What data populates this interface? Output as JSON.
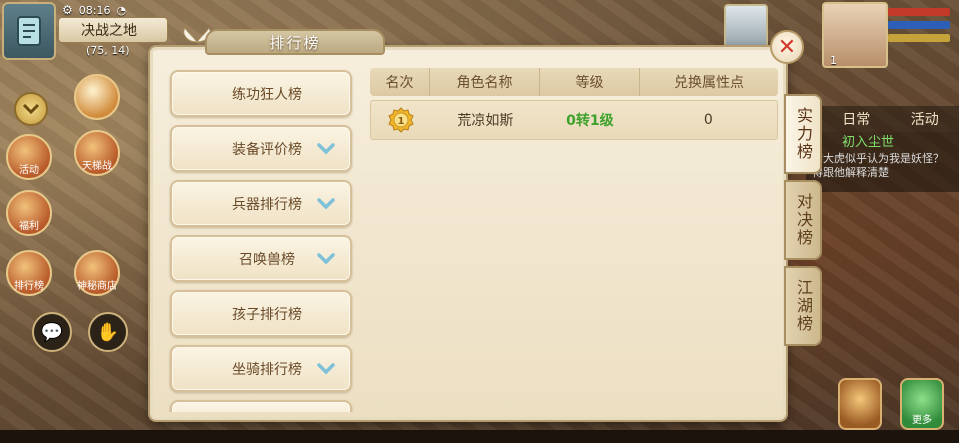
{
  "hud": {
    "time": "08:16",
    "location_name": "决战之地",
    "coords": "(75, 14)",
    "side_buttons": [
      "活动",
      "天梯战",
      "福利",
      "排行榜",
      "神秘商店"
    ],
    "right_tabs": [
      "日常",
      "活动"
    ],
    "quest_title": "初入尘世",
    "quest_text": "胡大虎似乎认为我是妖怪？得跟他解释清楚",
    "portrait_level": "1",
    "more_label": "更多"
  },
  "panel": {
    "title": "排行榜",
    "categories": [
      {
        "label": "练功狂人榜",
        "has_dropdown": false
      },
      {
        "label": "装备评价榜",
        "has_dropdown": true
      },
      {
        "label": "兵器排行榜",
        "has_dropdown": true
      },
      {
        "label": "召唤兽榜",
        "has_dropdown": true
      },
      {
        "label": "孩子排行榜",
        "has_dropdown": false
      },
      {
        "label": "坐骑排行榜",
        "has_dropdown": true
      }
    ],
    "table": {
      "headers": [
        "名次",
        "角色名称",
        "等级",
        "兑换属性点"
      ],
      "rows": [
        {
          "rank": "1",
          "name": "荒凉如斯",
          "level": "0转1级",
          "points": "0"
        }
      ]
    },
    "vertical_tabs": [
      "实力榜",
      "对决榜",
      "江湖榜"
    ],
    "active_vertical_tab": 0,
    "close_label": "✕"
  },
  "colors": {
    "accent_green": "#3fa22c",
    "close_red": "#d23a2a",
    "panel_bg": "#f6eedc",
    "text_brown": "#6a4a28"
  }
}
